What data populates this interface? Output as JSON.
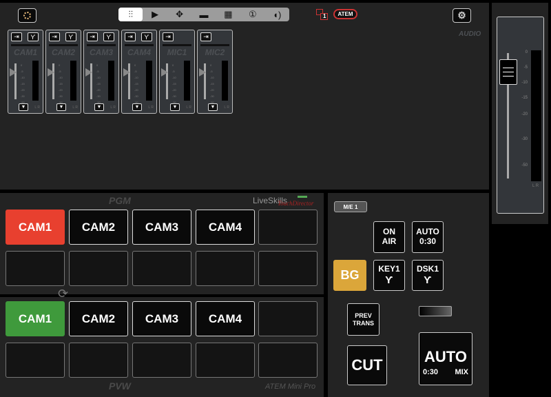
{
  "toolbar": {
    "settings_icon": "gear-ring-icon",
    "tabs": [
      {
        "icon": "mixer-sliders-icon",
        "label": "⫶⫶",
        "active": true
      },
      {
        "icon": "play-icon",
        "label": "▶"
      },
      {
        "icon": "move-icon",
        "label": "✥"
      },
      {
        "icon": "monitor-icon",
        "label": "▬"
      },
      {
        "icon": "multiview-icon",
        "label": "▦"
      },
      {
        "icon": "number-one-icon",
        "label": "①"
      },
      {
        "icon": "audio-icon",
        "label": "◖)"
      }
    ],
    "layer_badge": "1",
    "device_badge": "ATEM",
    "gear_icon": "gear-icon"
  },
  "audio": {
    "title": "AUDIO",
    "scale": [
      "0",
      "-5",
      "-10",
      "-15",
      "-20",
      "-30",
      "-50"
    ],
    "lr": "L R",
    "channels": [
      {
        "name": "CAM1"
      },
      {
        "name": "CAM2"
      },
      {
        "name": "CAM3"
      },
      {
        "name": "CAM4"
      },
      {
        "name": "MIC1"
      },
      {
        "name": "MIC2"
      }
    ],
    "master_level_db": -8
  },
  "switcher": {
    "pgm_label": "PGM",
    "pvw_label": "PVW",
    "brand": "LiveSkills",
    "brand_script": "TouchDirector",
    "device_name": "ATEM Mini Pro",
    "pgm": [
      "CAM1",
      "CAM2",
      "CAM3",
      "CAM4",
      ""
    ],
    "pvw": [
      "CAM1",
      "CAM2",
      "CAM3",
      "CAM4",
      ""
    ],
    "pgm_active": "CAM1",
    "pvw_active": "CAM1",
    "colors": {
      "program": "#e8402f",
      "preview": "#3f9a3c",
      "bg": "#dba63a"
    }
  },
  "transition": {
    "me": "M/E 1",
    "on_air": "ON AIR",
    "auto_small": "AUTO",
    "auto_small_time": "0:30",
    "bg": "BG",
    "key1": "KEY1",
    "dsk1": "DSK1",
    "prev_trans": "PREV TRANS",
    "cut": "CUT",
    "auto": "AUTO",
    "auto_time": "0:30",
    "auto_type": "MIX"
  }
}
